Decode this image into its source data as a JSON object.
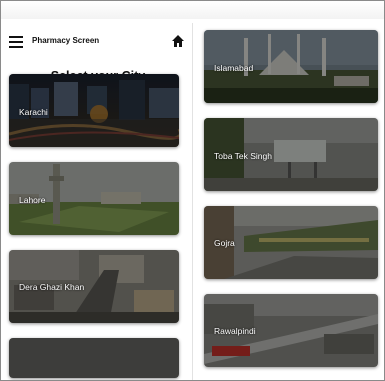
{
  "header": {
    "menu_icon": "hamburger-menu-icon",
    "title": "Pharmacy Screen",
    "home_icon": "home-icon"
  },
  "main": {
    "heading": "Select your City"
  },
  "cities": [
    {
      "name": "Karachi"
    },
    {
      "name": "Lahore"
    },
    {
      "name": "Dera Ghazi Khan"
    },
    {
      "name": "Islamabad"
    },
    {
      "name": "Toba Tek Singh"
    },
    {
      "name": "Gojra"
    },
    {
      "name": "Rawalpindi"
    }
  ],
  "colors": {
    "text": "#111111",
    "card_label": "#ffffff"
  }
}
